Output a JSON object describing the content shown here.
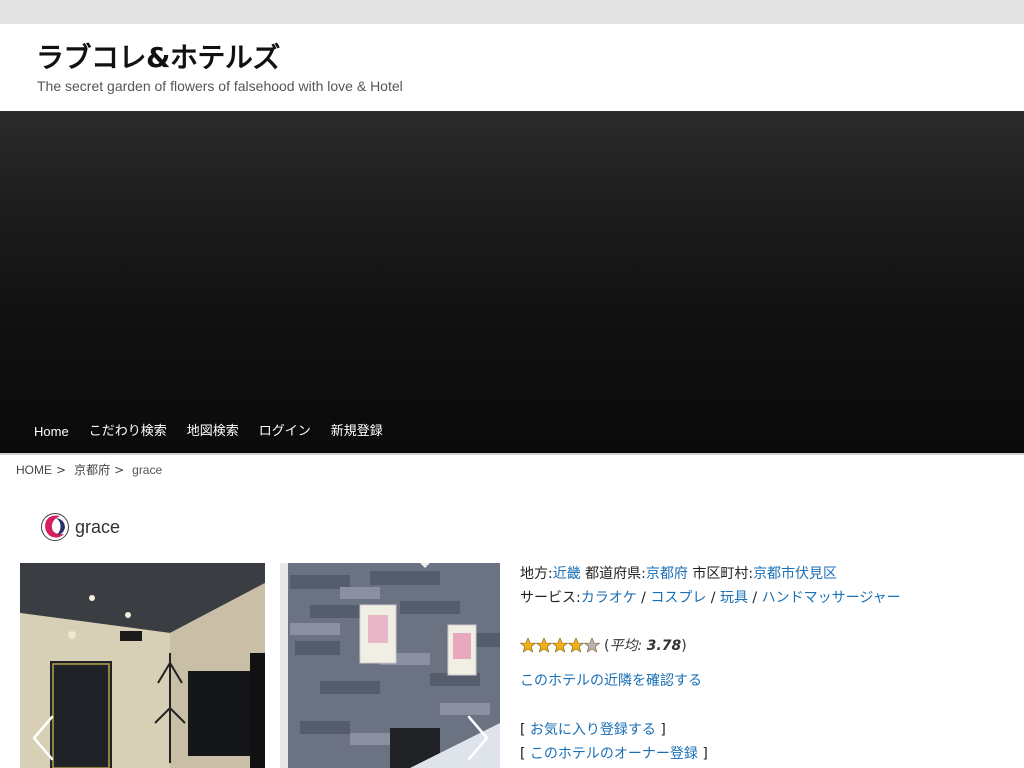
{
  "site": {
    "title": "ラブコレ&ホテルズ",
    "description": "The secret garden of flowers of falsehood with love & Hotel"
  },
  "nav": {
    "items": [
      "Home",
      "こだわり検索",
      "地図検索",
      "ログイン",
      "新規登録"
    ]
  },
  "breadcrumb": {
    "home": "HOME",
    "sep": ">",
    "prefecture": "京都府",
    "current": "grace"
  },
  "hotel": {
    "name": "grace",
    "region_label": "地方",
    "region": "近畿",
    "pref_label": "都道府県",
    "pref": "京都府",
    "city_label": "市区町村",
    "city": "京都市伏見区",
    "service_label": "サービス",
    "services": [
      "カラオケ",
      "コスプレ",
      "玩具",
      "ハンドマッサージャー"
    ],
    "colon": ":",
    "slash": "/"
  },
  "rating": {
    "value": 3.78,
    "max": 5,
    "avg_label": "平均:",
    "avg_value": "3.78",
    "open_paren": "(",
    "close_paren": ")"
  },
  "links": {
    "nearby": "このホテルの近隣を確認する",
    "favorite": "お気に入り登録する",
    "owner": "このホテルのオーナー登録",
    "open_bracket": "[",
    "close_bracket": "]"
  },
  "colors": {
    "link": "#1a6fb5",
    "star": "#f2b21b",
    "topbar": "#e3e3e3"
  },
  "icons": {
    "logo": "grace-logo-icon",
    "prev": "chevron-left-icon",
    "next": "chevron-right-icon",
    "star": "star-icon"
  }
}
